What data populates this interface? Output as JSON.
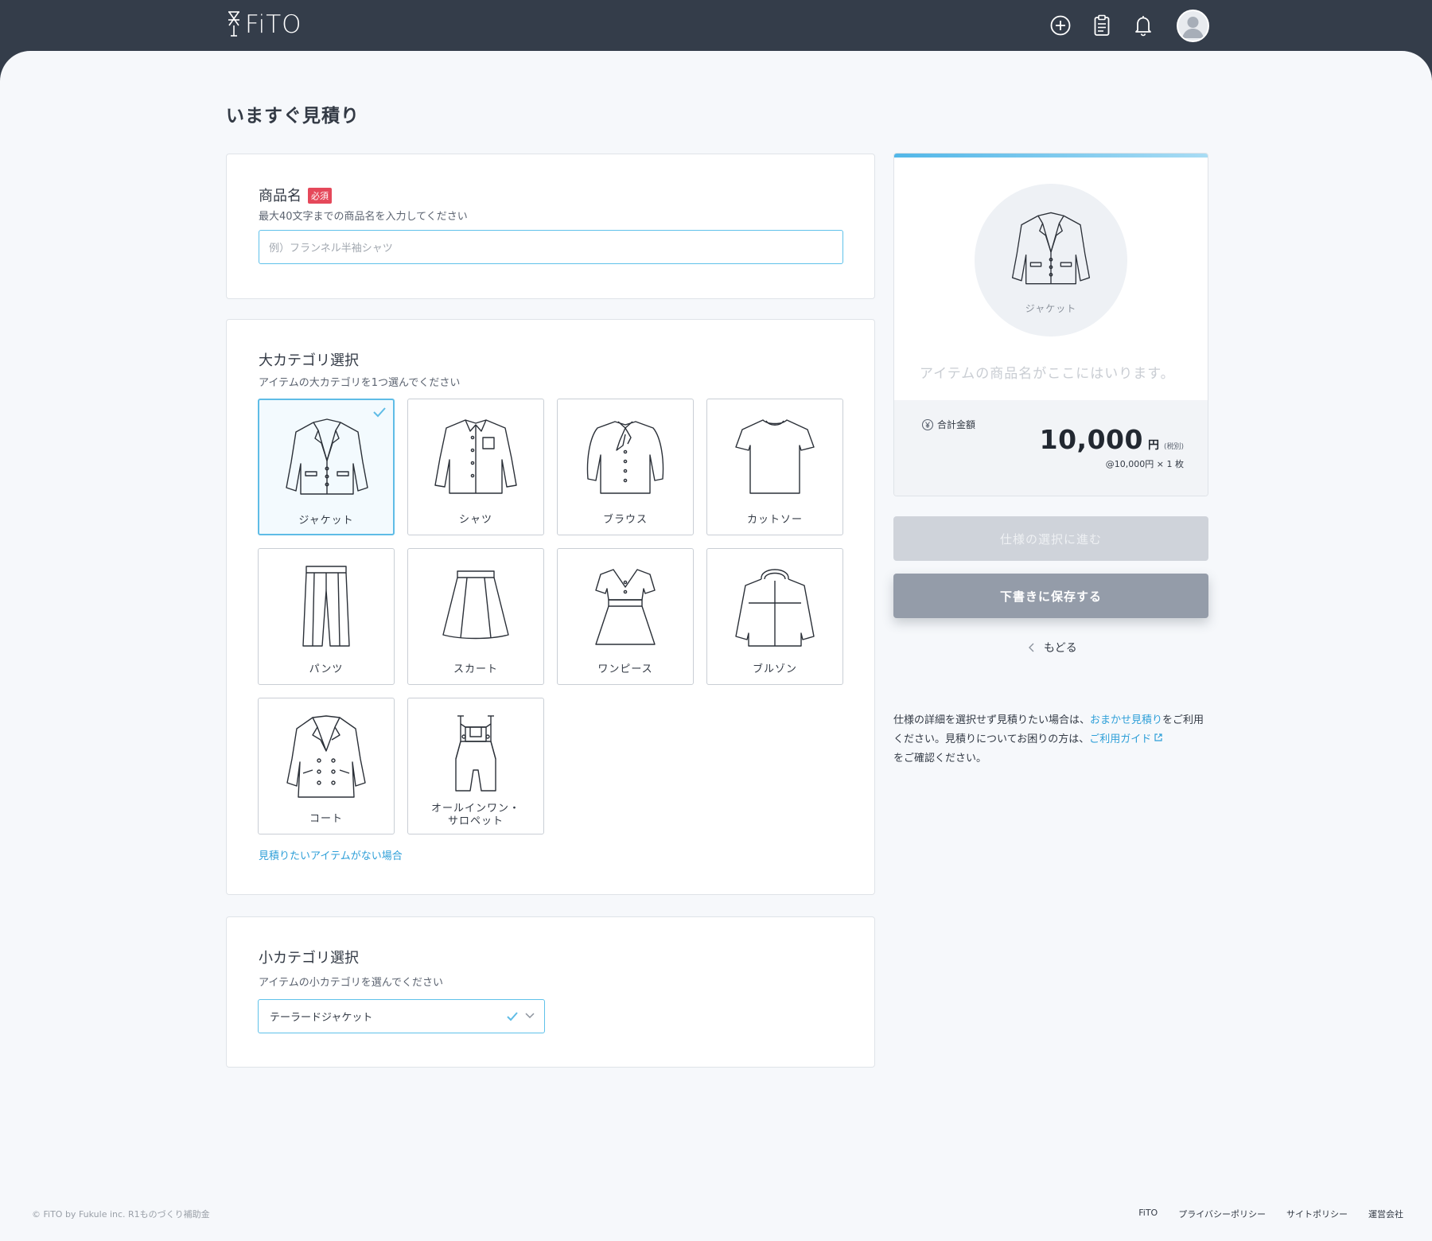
{
  "header": {
    "brand": "FiTO"
  },
  "page": {
    "title": "いますぐ見積り"
  },
  "product_name": {
    "title": "商品名",
    "required_badge": "必須",
    "description": "最大40文字までの商品名を入力してください",
    "placeholder": "例）フランネル半袖シャツ",
    "value": ""
  },
  "main_category": {
    "title": "大カテゴリ選択",
    "description": "アイテムの大カテゴリを1つ選んでください",
    "selected": "ジャケット",
    "items": [
      {
        "label": "ジャケット",
        "icon": "jacket-icon"
      },
      {
        "label": "シャツ",
        "icon": "shirt-icon"
      },
      {
        "label": "ブラウス",
        "icon": "blouse-icon"
      },
      {
        "label": "カットソー",
        "icon": "tshirt-icon"
      },
      {
        "label": "パンツ",
        "icon": "pants-icon"
      },
      {
        "label": "スカート",
        "icon": "skirt-icon"
      },
      {
        "label": "ワンピース",
        "icon": "dress-icon"
      },
      {
        "label": "ブルゾン",
        "icon": "blouson-icon"
      },
      {
        "label": "コート",
        "icon": "coat-icon"
      },
      {
        "label": "オールインワン・\nサロペット",
        "icon": "overalls-icon"
      }
    ],
    "missing_link": "見積りたいアイテムがない場合"
  },
  "sub_category": {
    "title": "小カテゴリ選択",
    "description": "アイテムの小カテゴリを選んでください",
    "selected_value": "テーラードジャケット"
  },
  "preview": {
    "category_caption": "ジャケット",
    "name_placeholder": "アイテムの商品名がここにはいります。",
    "total_label": "合計金額",
    "total_amount": "10,000",
    "currency": "円",
    "tax_note": "(税別)",
    "unit_line": "@10,000円 × 1 枚"
  },
  "actions": {
    "next_label": "仕様の選択に進む",
    "draft_label": "下書きに保存する",
    "back_label": "もどる"
  },
  "help": {
    "text_1": "仕様の詳細を選択せず見積りたい場合は、",
    "link_1": "おまかせ見積り",
    "text_2": "をご利用ください。見積りについてお困りの方は、",
    "link_2": "ご利用ガイド",
    "text_3": "をご確認ください。"
  },
  "footer": {
    "copyright": "© FiTO by Fukule inc. R1ものづくり補助金",
    "links": [
      "FiTO",
      "プライバシーポリシー",
      "サイトポリシー",
      "運営会社"
    ]
  },
  "colors": {
    "header_bg": "#343d4a",
    "accent": "#5fbce6",
    "link": "#2e9fd8",
    "required": "#e5485a",
    "draft_button": "#949ca9",
    "next_button_disabled": "#cfd3da"
  }
}
